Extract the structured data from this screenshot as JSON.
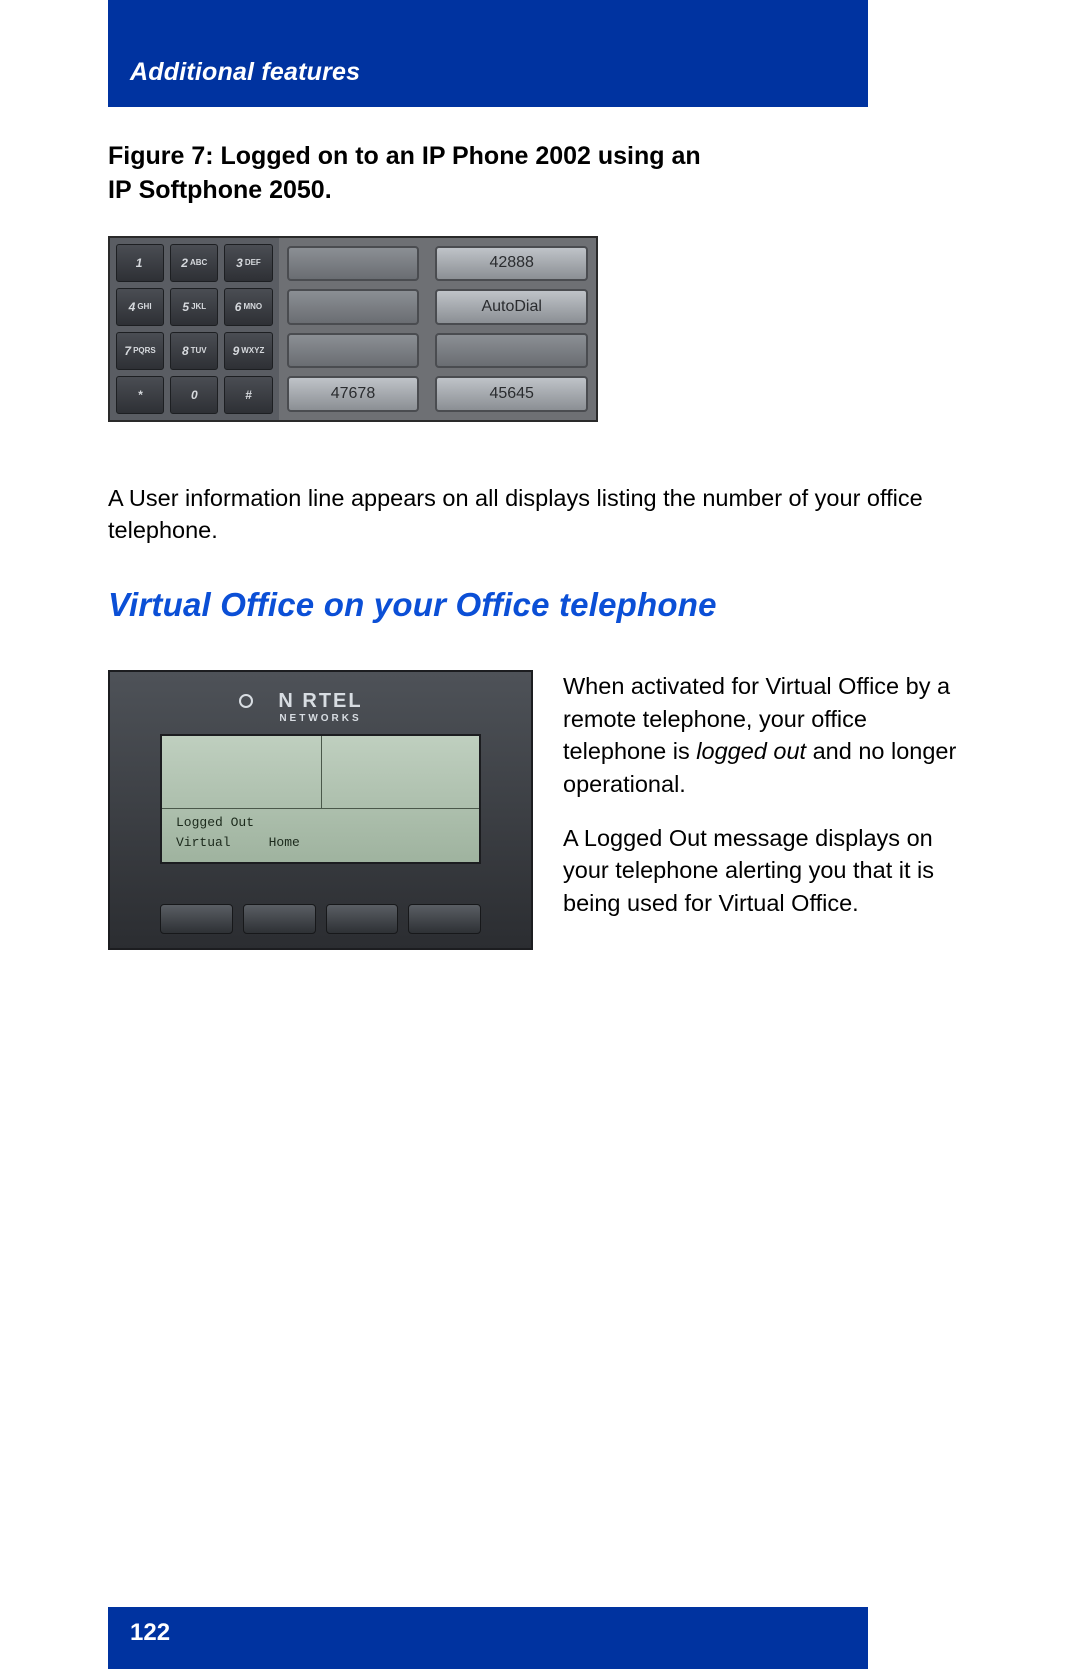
{
  "header": {
    "title": "Additional features"
  },
  "figure7": {
    "caption": "Figure 7: Logged on to an IP Phone 2002 using an IP Softphone 2050.",
    "keypad_keys": [
      {
        "n": "1",
        "s": ""
      },
      {
        "n": "2",
        "s": "ABC"
      },
      {
        "n": "3",
        "s": "DEF"
      },
      {
        "n": "4",
        "s": "GHI"
      },
      {
        "n": "5",
        "s": "JKL"
      },
      {
        "n": "6",
        "s": "MNO"
      },
      {
        "n": "7",
        "s": "PQRS"
      },
      {
        "n": "8",
        "s": "TUV"
      },
      {
        "n": "9",
        "s": "WXYZ"
      },
      {
        "n": "*",
        "s": ""
      },
      {
        "n": "0",
        "s": ""
      },
      {
        "n": "#",
        "s": ""
      }
    ],
    "mid_buttons": [
      "",
      "",
      "",
      "47678"
    ],
    "right_buttons": [
      "42888",
      "AutoDial",
      "",
      "45645"
    ]
  },
  "para_after_fig7": "A User information line appears on all displays listing the number of your office telephone.",
  "section_h2": "Virtual Office on your Office telephone",
  "phone_fig": {
    "brand_top": "N   RTEL",
    "brand_sub": "NETWORKS",
    "screen_line1": "Logged Out",
    "screen_line2_a": "Virtual",
    "screen_line2_b": "Home"
  },
  "right_paras": {
    "p1_a": "When activated for Virtual Office by a remote telephone, your office telephone is ",
    "p1_em": "logged out",
    "p1_b": " and no longer operational.",
    "p2": "A Logged Out message displays on your telephone alerting you that it is being used for Virtual Office."
  },
  "footer": {
    "page": "122"
  }
}
